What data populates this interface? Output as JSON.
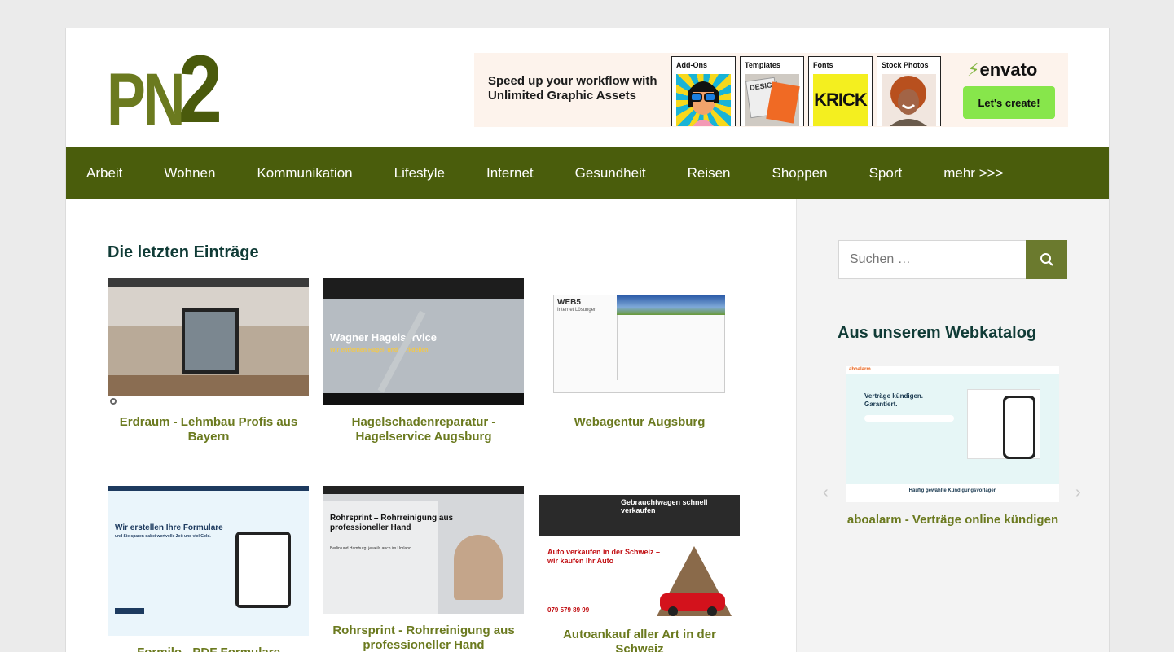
{
  "logo": {
    "pn": "PN",
    "two": "2"
  },
  "banner": {
    "headline": "Speed up your workflow with Unlimited Graphic Assets",
    "cards": [
      "Add-Ons",
      "Templates",
      "Fonts",
      "Stock Photos"
    ],
    "font_sample": "KRICK",
    "template_sample": "DESIGN",
    "brand": "envato",
    "cta": "Let's create!"
  },
  "nav": {
    "items": [
      "Arbeit",
      "Wohnen",
      "Kommunikation",
      "Lifestyle",
      "Internet",
      "Gesundheit",
      "Reisen",
      "Shoppen",
      "Sport",
      "mehr >>>"
    ]
  },
  "main": {
    "title": "Die letzten Einträge",
    "entries": [
      {
        "title": "Erdraum - Lehmbau Profis aus Bayern"
      },
      {
        "title": "Hagelschadenreparatur - Hagelservice Augsburg",
        "thumb_text": "Wagner Hagelservice",
        "thumb_sub": "Wir entfernen Hagel- und Parkdellen"
      },
      {
        "title": "Webagentur Augsburg",
        "thumb_text": "WEB5",
        "thumb_sub": "Internet Lösungen"
      },
      {
        "title": "Formilo - PDF Formulare",
        "thumb_text": "Wir erstellen Ihre Formulare",
        "thumb_sub": "und Sie sparen dabei wertvolle Zeit und viel Geld."
      },
      {
        "title": "Rohrsprint - Rohrreinigung aus professioneller Hand",
        "thumb_text": "Rohrsprint – Rohrreinigung aus professioneller Hand",
        "thumb_sub": "Berlin und Hamburg, jeweils auch im Umland"
      },
      {
        "title": "Autoankauf aller Art in der Schweiz",
        "thumb_text": "Auto verkaufen in der Schweiz – wir kaufen Ihr Auto",
        "thumb_sub": "Gebrauchtwagen schnell verkaufen",
        "thumb_phone": "079 579 89 99"
      }
    ]
  },
  "sidebar": {
    "search_placeholder": "Suchen …",
    "title": "Aus unserem Webkatalog",
    "featured": {
      "brand": "aboalarm",
      "headline": "Verträge kündigen. Garantiert.",
      "footer": "Häufig gewählte Kündigungsvorlagen",
      "caption": "aboalarm - Verträge online kündigen"
    },
    "prev": "‹",
    "next": "›"
  },
  "colors": {
    "nav": "#4a5d0c",
    "accent": "#6b7a1f",
    "heading": "#103b36"
  }
}
